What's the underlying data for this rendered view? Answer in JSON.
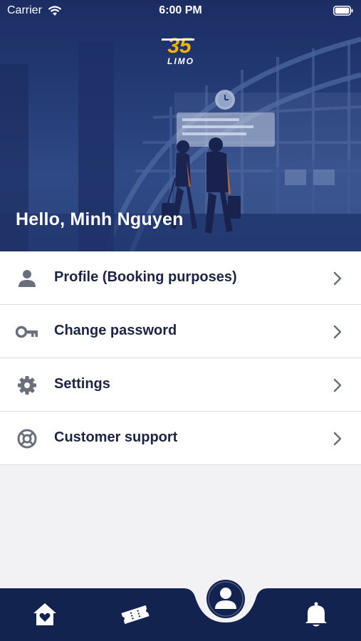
{
  "status_bar": {
    "carrier": "Carrier",
    "time": "6:00 PM"
  },
  "brand": {
    "logo_number": "35",
    "logo_text": "LIMO",
    "accent": "#f5b400",
    "navy": "#13234f"
  },
  "header": {
    "greeting": "Hello, Minh Nguyen"
  },
  "menu": {
    "items": [
      {
        "label": "Profile (Booking purposes)",
        "icon": "person-icon"
      },
      {
        "label": "Change password",
        "icon": "key-icon"
      },
      {
        "label": "Settings",
        "icon": "gear-icon"
      },
      {
        "label": "Customer support",
        "icon": "lifebuoy-icon"
      }
    ]
  },
  "tabbar": {
    "tabs": [
      {
        "name": "home",
        "icon": "home-heart-icon"
      },
      {
        "name": "tickets",
        "icon": "ticket-icon"
      },
      {
        "name": "account",
        "icon": "user-icon",
        "active": true
      },
      {
        "name": "notifications",
        "icon": "bell-icon"
      }
    ]
  }
}
